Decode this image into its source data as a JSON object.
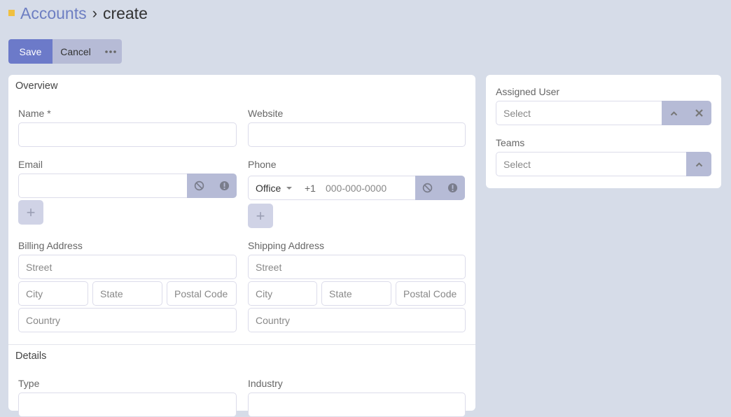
{
  "header": {
    "breadcrumb_link": "Accounts",
    "separator": "›",
    "current": "create",
    "accent_color": "#f0c040"
  },
  "toolbar": {
    "save_label": "Save",
    "cancel_label": "Cancel",
    "more_label": "•••"
  },
  "overview": {
    "title": "Overview",
    "name_label": "Name *",
    "name_value": "",
    "website_label": "Website",
    "website_value": "",
    "email_label": "Email",
    "email_value": "",
    "phone_label": "Phone",
    "phone_type": "Office",
    "phone_country_code": "+1",
    "phone_placeholder": "000-000-0000",
    "add_label": "+",
    "billing_label": "Billing Address",
    "shipping_label": "Shipping Address",
    "address_placeholders": {
      "street": "Street",
      "city": "City",
      "state": "State",
      "postal_code": "Postal Code",
      "country": "Country"
    }
  },
  "details": {
    "title": "Details",
    "type_label": "Type",
    "industry_label": "Industry"
  },
  "side": {
    "assigned_user_label": "Assigned User",
    "assigned_user_placeholder": "Select",
    "teams_label": "Teams",
    "teams_placeholder": "Select"
  },
  "icons": {
    "opt_out": "⃠",
    "invalid": "!",
    "chevron_up": "⌃",
    "close": "✕"
  },
  "colors": {
    "primary": "#6c7ac9",
    "secondary": "#b6bbd6",
    "background": "#d6dce8",
    "link": "#6d7ec2"
  }
}
